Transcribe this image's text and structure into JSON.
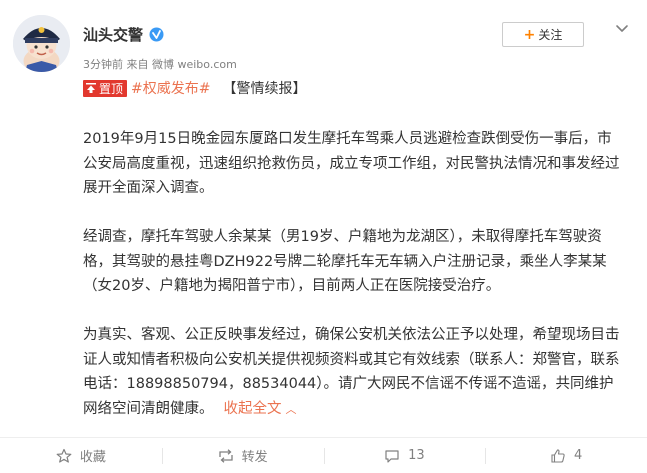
{
  "header": {
    "author_name": "汕头交警",
    "meta_text": "3分钟前 来自 微博 weibo.com",
    "follow_label": "关注"
  },
  "tagline": {
    "pin_label": "置顶",
    "topic": "#权威发布#",
    "headline": "【警情续报】"
  },
  "post": {
    "paragraphs": [
      "2019年9月15日晚金园东厦路口发生摩托车驾乘人员逃避检查跌倒受伤一事后，市公安局高度重视，迅速组织抢救伤员，成立专项工作组，对民警执法情况和事发经过展开全面深入调查。",
      "经调查，摩托车驾驶人余某某（男19岁、户籍地为龙湖区），未取得摩托车驾驶资格，其驾驶的悬挂粤DZH922号牌二轮摩托车无车辆入户注册记录，乘坐人李某某（女20岁、户籍地为揭阳普宁市），目前两人正在医院接受治疗。",
      "为真实、客观、公正反映事发经过，确保公安机关依法公正予以处理，希望现场目击证人或知情者积极向公安机关提供视频资料或其它有效线索（联系人：郑警官，联系电话：18898850794，88534044）。请广大网民不信谣不传谣不造谣，共同维护网络空间清朗健康。"
    ],
    "collapse_label": "收起全文"
  },
  "footer": {
    "favorite_label": "收藏",
    "repost_label": "转发",
    "comment_count": "13",
    "like_count": "4"
  },
  "icons": [
    "avatar",
    "verified-icon",
    "more-icon",
    "pin-icon",
    "star-icon",
    "repost-icon",
    "comment-icon",
    "like-icon"
  ],
  "colors": {
    "accent": "#eb7350",
    "follow_plus": "#ff8200",
    "pin_badge": "#e2382e",
    "verified": "#ffc028",
    "meta": "#808080"
  }
}
